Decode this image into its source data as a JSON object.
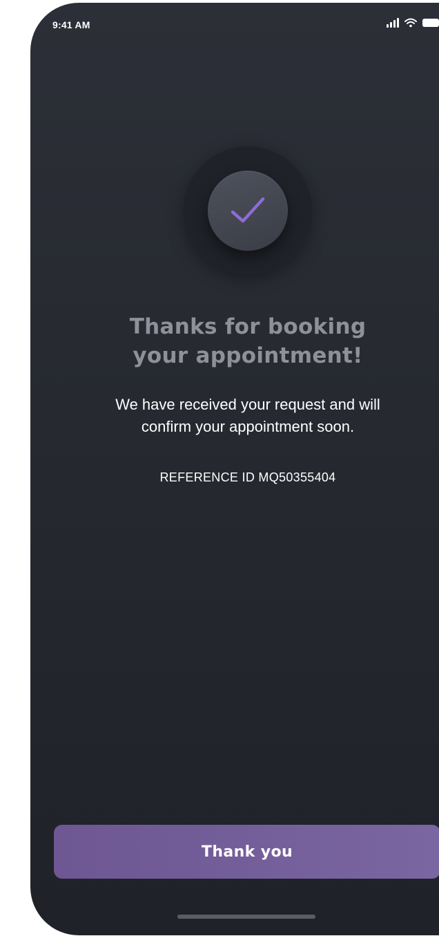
{
  "status_bar": {
    "time": "9:41 AM",
    "icons": [
      "signal-icon",
      "wifi-icon",
      "battery-icon"
    ]
  },
  "confirmation": {
    "icon": "checkmark-icon",
    "title": "Thanks for booking\nyour appointment!",
    "message": "We have received your request and will\nconfirm your appointment soon.",
    "reference": "REFERENCE ID  MQ50355404"
  },
  "actions": {
    "primary_label": "Thank you"
  },
  "colors": {
    "background": "#2a2d35",
    "accent": "#7a66a1",
    "check": "#8e6bd6",
    "title": "#8e9199",
    "text": "#ffffff"
  }
}
